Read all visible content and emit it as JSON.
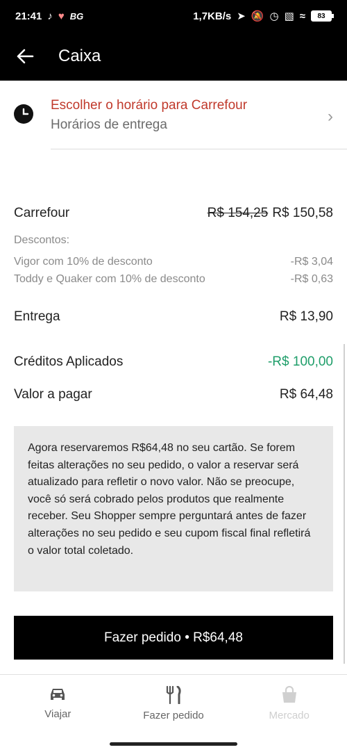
{
  "status": {
    "time": "21:41",
    "left_extra": "BG",
    "speed": "1,7KB/s",
    "battery": "83"
  },
  "appbar": {
    "title": "Caixa"
  },
  "schedule": {
    "title": "Escolher o horário para Carrefour",
    "subtitle": "Horários de entrega"
  },
  "summary": {
    "store": "Carrefour",
    "old_price": "R$ 154,25",
    "new_price": "R$ 150,58",
    "discounts_header": "Descontos:",
    "discounts": [
      {
        "label": "Vigor com 10% de desconto",
        "value": "-R$ 3,04"
      },
      {
        "label": "Toddy e Quaker com 10% de desconto",
        "value": "-R$ 0,63"
      }
    ],
    "delivery_label": "Entrega",
    "delivery_value": "R$ 13,90",
    "credits_label": "Créditos Aplicados",
    "credits_value": "-R$ 100,00",
    "total_label": "Valor a pagar",
    "total_value": "R$ 64,48"
  },
  "info": "Agora reservaremos R$64,48 no seu cartão. Se forem feitas alterações no seu pedido, o valor a reservar será atualizado para refletir o novo valor. Não se preocupe, você só será cobrado pelos produtos que realmente receber. Seu Shopper sempre perguntará antes de fazer alterações no seu pedido e seu cupom fiscal final refletirá o valor total coletado.",
  "cta": "Fazer pedido • R$64,48",
  "nav": [
    {
      "label": "Viajar",
      "icon": "car-icon"
    },
    {
      "label": "Fazer pedido",
      "icon": "fork-knife-icon"
    },
    {
      "label": "Mercado",
      "icon": "shopping-bag-icon"
    }
  ],
  "colors": {
    "accent": "#c0392b",
    "credit_green": "#1f9e6a"
  }
}
